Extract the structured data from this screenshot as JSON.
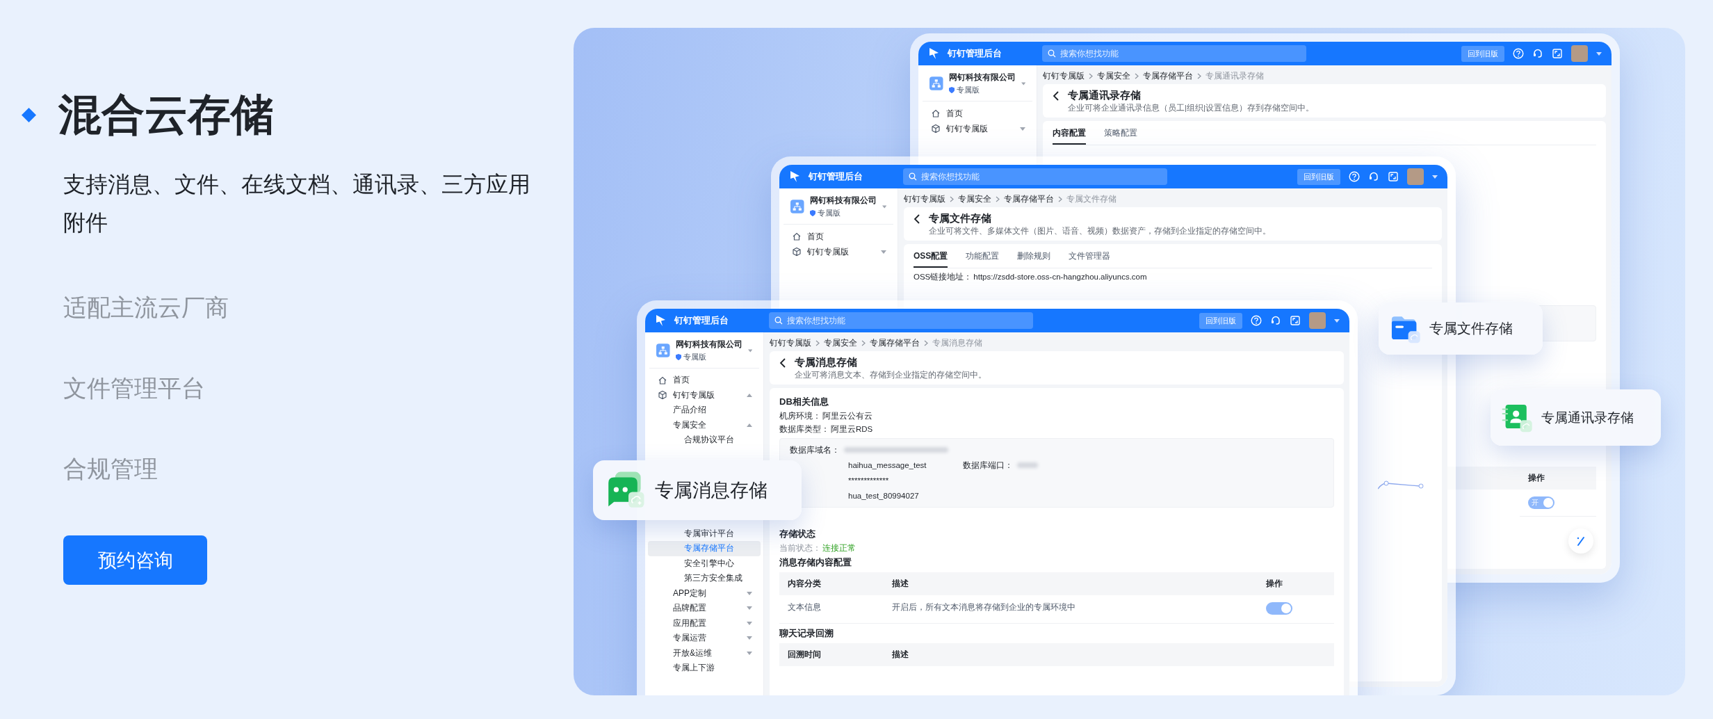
{
  "hero": {
    "nav_items": [
      {
        "label": "混合云存储",
        "selected": true,
        "description": "支持消息、文件、在线文档、通讯录、三方应用附件"
      },
      {
        "label": "适配主流云厂商",
        "selected": false
      },
      {
        "label": "文件管理平台",
        "selected": false
      },
      {
        "label": "合规管理",
        "selected": false
      }
    ],
    "cta_button": "预约咨询"
  },
  "windows": [
    {
      "app_title": "钉钉管理后台",
      "search_placeholder": "搜索你想找功能",
      "company": {
        "name": "网钉科技有限公司",
        "badge": "专属版"
      },
      "sidebar": [
        {
          "label": "首页",
          "selected": false
        },
        {
          "label": "钉钉专属版",
          "selected": false,
          "expanded": false
        }
      ],
      "header_button": "回到旧版",
      "breadcrumb": [
        "钉钉专属版",
        "专属安全",
        "专属存储平台",
        "专属通讯录存储"
      ],
      "page_title": "专属通讯录存储",
      "page_description": "企业可将企业通讯录信息（员工|组织|设置信息）存到存储空间中。",
      "sections": [
        {
          "kind": "tabs",
          "tabs": [
            {
              "label": "内容配置",
              "selected": true
            },
            {
              "label": "策略配置",
              "selected": false
            }
          ]
        },
        {
          "kind": "panel"
        },
        {
          "kind": "table",
          "columns": [
            "操作"
          ],
          "rows": [
            {
              "toggle": {
                "label": "开",
                "on": true
              }
            }
          ]
        },
        {
          "kind": "fab"
        }
      ]
    },
    {
      "app_title": "钉钉管理后台",
      "search_placeholder": "搜索你想找功能",
      "company": {
        "name": "网钉科技有限公司",
        "badge": "专属版"
      },
      "sidebar": [
        {
          "label": "首页",
          "selected": false
        },
        {
          "label": "钉钉专属版",
          "selected": false,
          "expanded": false
        }
      ],
      "header_button": "回到旧版",
      "breadcrumb": [
        "钉钉专属版",
        "专属安全",
        "专属存储平台",
        "专属文件存储"
      ],
      "page_title": "专属文件存储",
      "page_description": "企业可将文件、多媒体文件（图片、语音、视频）数据资产，存储到企业指定的存储空间中。",
      "sections": [
        {
          "kind": "tabs",
          "tabs": [
            {
              "label": "OSS配置",
              "selected": true
            },
            {
              "label": "功能配置",
              "selected": false
            },
            {
              "label": "删除规则",
              "selected": false
            },
            {
              "label": "文件管理器",
              "selected": false
            }
          ]
        },
        {
          "kind": "field",
          "label": "OSS链接地址：",
          "value": "https://zsdd-store.oss-cn-hangzhou.aliyuncs.com"
        },
        {
          "kind": "graph"
        }
      ]
    },
    {
      "app_title": "钉钉管理后台",
      "search_placeholder": "搜索你想找功能",
      "company": {
        "name": "网钉科技有限公司",
        "badge": "专属版"
      },
      "sidebar": [
        {
          "label": "首页",
          "selected": false
        },
        {
          "label": "钉钉专属版",
          "selected": false,
          "expanded": true,
          "children": [
            {
              "label": "产品介绍",
              "selected": false
            },
            {
              "label": "专属安全",
              "selected": false,
              "expanded": true,
              "children": [
                {
                  "label": "合规协议平台",
                  "selected": false
                },
                {
                  "label": "专属审计平台",
                  "selected": false
                },
                {
                  "label": "专属存储平台",
                  "selected": true
                },
                {
                  "label": "安全引擎中心",
                  "selected": false
                },
                {
                  "label": "第三方安全集成",
                  "selected": false
                }
              ]
            },
            {
              "label": "APP定制",
              "selected": false,
              "expanded": false
            },
            {
              "label": "品牌配置",
              "selected": false,
              "expanded": false
            },
            {
              "label": "应用配置",
              "selected": false,
              "expanded": false
            },
            {
              "label": "专属运营",
              "selected": false,
              "expanded": false
            },
            {
              "label": "开放&运维",
              "selected": false,
              "expanded": false
            },
            {
              "label": "专属上下游",
              "selected": false
            }
          ]
        }
      ],
      "header_button": "回到旧版",
      "breadcrumb": [
        "钉钉专属版",
        "专属安全",
        "专属存储平台",
        "专属消息存储"
      ],
      "page_title": "专属消息存储",
      "page_description": "企业可将消息文本、存储到企业指定的存储空间中。",
      "sections": [
        {
          "kind": "heading",
          "text": "DB相关信息"
        },
        {
          "kind": "field",
          "label": "机房环境：",
          "value": "阿里云公有云"
        },
        {
          "kind": "field",
          "label": "数据库类型：",
          "value": "阿里云RDS"
        },
        {
          "kind": "panel",
          "rows": [
            {
              "label": "数据库域名：",
              "blurred": true
            },
            {
              "value": "haihua_message_test",
              "second_label": "数据库端口：",
              "second_blurred": true
            },
            {
              "value": "*************"
            },
            {
              "value": "hua_test_80994027"
            }
          ]
        },
        {
          "kind": "heading",
          "text": "存储状态"
        },
        {
          "kind": "status",
          "label": "当前状态：",
          "value": "连接正常",
          "healthy": true
        },
        {
          "kind": "heading",
          "text": "消息存储内容配置"
        },
        {
          "kind": "table",
          "columns": [
            "内容分类",
            "描述",
            "操作"
          ],
          "rows": [
            {
              "cells": [
                "文本信息",
                "开启后，所有文本消息将存储到企业的专属环境中"
              ],
              "toggle": {
                "on": true
              }
            }
          ]
        },
        {
          "kind": "heading",
          "text": "聊天记录回溯"
        },
        {
          "kind": "table",
          "columns": [
            "回溯时间",
            "描述"
          ]
        }
      ]
    }
  ],
  "feature_cards": [
    {
      "kind": "message",
      "label": "专属消息存储"
    },
    {
      "kind": "file",
      "label": "专属文件存储"
    },
    {
      "kind": "contacts",
      "label": "专属通讯录存储"
    }
  ]
}
